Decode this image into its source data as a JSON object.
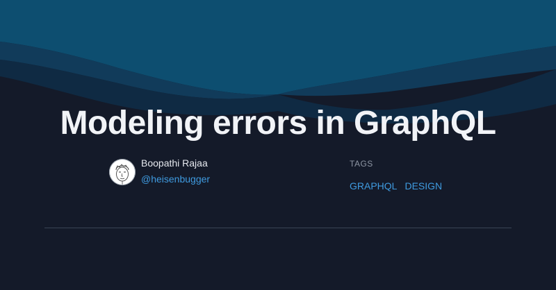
{
  "post": {
    "title": "Modeling errors in GraphQL"
  },
  "author": {
    "name": "Boopathi Rajaa",
    "handle": "@heisenbugger",
    "avatar_icon": "hand-drawn-face-avatar"
  },
  "tags": {
    "heading": "TAGS",
    "items": [
      "GRAPHQL",
      "DESIGN"
    ]
  },
  "colors": {
    "background": "#141a29",
    "wave_top": "#0d4e70",
    "wave_middle": "#113b5a",
    "wave_back": "#0f2a43",
    "accent_link": "#3f9be0",
    "title": "#f1f3f7"
  }
}
